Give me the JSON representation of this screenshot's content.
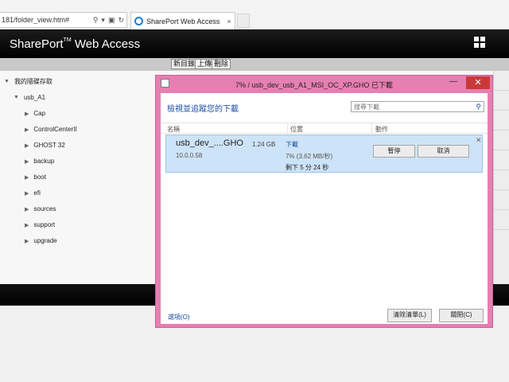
{
  "browser": {
    "url": "181/folder_view.htm#",
    "tab_title": "SharePort Web Access",
    "tab_close": "×"
  },
  "app": {
    "title_main": "SharePort",
    "title_tm": "TM",
    "title_rest": " Web Access",
    "actions": [
      "新目錄",
      "上傳",
      "刪除"
    ]
  },
  "tree": {
    "root": "我的隨碟存取",
    "drive": "usb_A1",
    "folders": [
      "Cap",
      "ControlCenterII",
      "GHOST 32",
      "backup",
      "boot",
      "efi",
      "sources",
      "support",
      "upgrade"
    ]
  },
  "dialog": {
    "title": "7% / usb_dev_usb_A1_MSI_OC_XP.GHO 已下載",
    "heading": "檢視並追蹤您的下載",
    "search_placeholder": "搜尋下載",
    "columns": {
      "name": "名稱",
      "location": "位置",
      "action": "動作"
    },
    "download": {
      "name": "usb_dev_....GHO",
      "size": "1.24 GB",
      "source": "10.0.0.58",
      "status": "下載",
      "progress": "7% (3.62 MB/秒)",
      "remaining": "剩下 5 分 24 秒",
      "pause_label": "暫停",
      "cancel_label": "取消",
      "progress_percent": 7
    },
    "options_link": "選項(O)",
    "clear_label": "清除清單(L)",
    "close_label": "關閉(C)"
  }
}
